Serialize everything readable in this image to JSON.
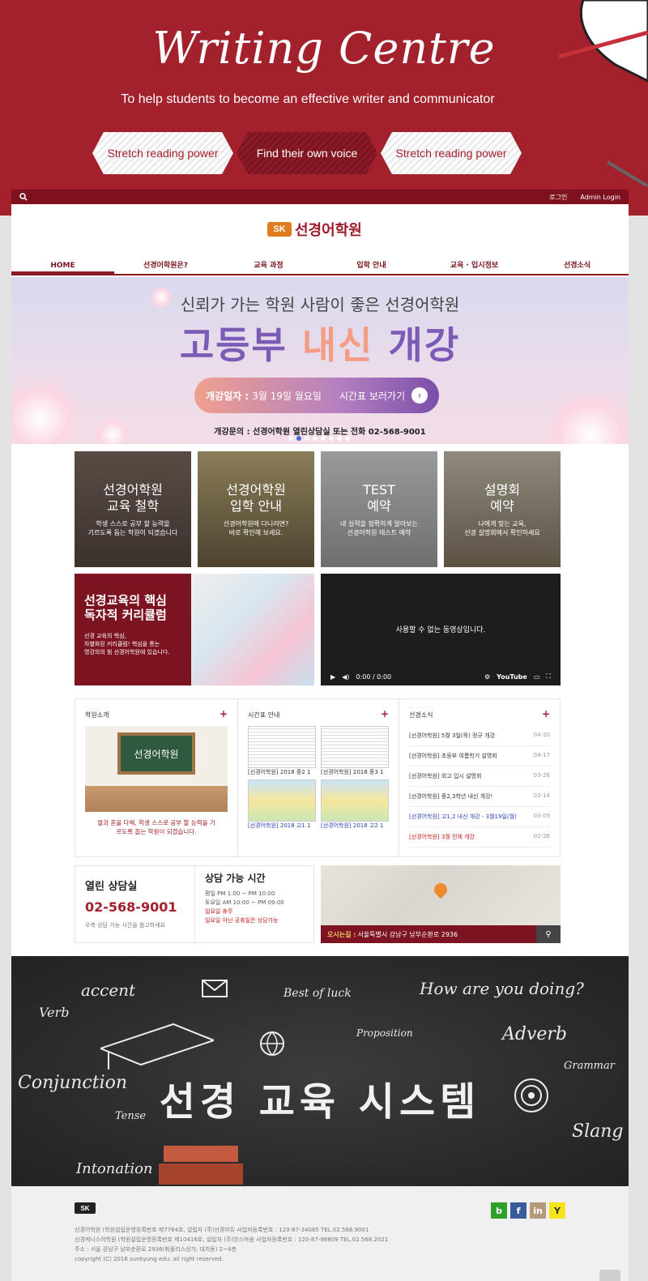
{
  "hero": {
    "title": "Writing Centre",
    "tagline": "To help students to become an effective writer and communicator",
    "pills": [
      "Stretch reading power",
      "Find their own voice",
      "Stretch reading power"
    ]
  },
  "topbar": {
    "search_icon": "search-icon",
    "login": "로그인",
    "admin": "Admin Login"
  },
  "logo": {
    "mark": "SK",
    "name": "선경어학원"
  },
  "nav": [
    "HOME",
    "선경어학원은?",
    "교육 과정",
    "입학 안내",
    "교육 · 입시정보",
    "선경소식"
  ],
  "banner": {
    "subtitle": "신뢰가 가는 학원 사람이 좋은 선경어학원",
    "title_a": "고등부 ",
    "title_b": "내신",
    "title_c": " 개강",
    "cta_label": "개강일자 :",
    "cta_date": "3월 19일 월요일",
    "cta_link": "시간표 보러가기",
    "info": "개강문의 : 선경어학원 열린상담실 또는 전화 02-568-9001"
  },
  "tiles": [
    {
      "title1": "선경어학원",
      "title2": "교육 철학",
      "sub1": "학생 스스로 공부 할 능력을",
      "sub2": "기르도록 돕는 학원이 되겠습니다"
    },
    {
      "title1": "선경어학원",
      "title2": "입학 안내",
      "sub1": "선경어학원에 다니려면?",
      "sub2": "바로 확인해 보세요."
    },
    {
      "title1": "TEST",
      "title2": "예약",
      "sub1": "내 실력을 정확하게 알아보는",
      "sub2": "선경어학원 테스트 예약"
    },
    {
      "title1": "설명회",
      "title2": "예약",
      "sub1": "나에게 맞는 교육,",
      "sub2": "선경 설명회에서 확인하세요"
    }
  ],
  "feature": {
    "title1": "선경교육의 핵심",
    "title2": "독자적 커리큘럼",
    "sub1": "선경 교육의 핵심,",
    "sub2": "차별화된 커리큘럼! 핵심을 통는",
    "sub3": "명강의의 힘 선경어학원에 있습니다."
  },
  "video": {
    "message": "사용할 수 없는 동영상입니다.",
    "time": "0:00 / 0:00",
    "brand": "YouTube"
  },
  "about": {
    "heading": "학원소개",
    "board_text": "선경어학원",
    "caption1": "열과 혼을 다해, 학생 스스로 공부 할 능력을 기",
    "caption2": "르도록 돕는 학원이 되겠습니다."
  },
  "timetable": {
    "heading": "시간표 안내",
    "items": [
      {
        "label": "[선경어학원] 2018 중2 1"
      },
      {
        "label": "[선경어학원] 2018 중3 1"
      },
      {
        "label": "[선경어학원] 2018 고1 1"
      },
      {
        "label": "[선경어학원] 2018 고2 1"
      }
    ]
  },
  "news": {
    "heading": "선경소식",
    "items": [
      {
        "text": "[선경어학원] 5월 3일(목) 정규 개강",
        "date": "04-20"
      },
      {
        "text": "[선경어학원] 초등부 여름학기 설명회",
        "date": "04-17"
      },
      {
        "text": "[선경어학원] 외고 입시 설명회",
        "date": "03-26"
      },
      {
        "text": "[선경어학원] 중2,3학년 내신 개강!",
        "date": "03-14"
      },
      {
        "text": "[선경어학원] 고1,2 내신 개강 - 3월19일(월)",
        "date": "03-09"
      },
      {
        "text": "[선경어학원] 3월 전체 개강",
        "date": "02-26"
      }
    ]
  },
  "contact": {
    "heading": "열린 상담실",
    "phone": "02-568-9001",
    "note": "우측 상담 가능 시간을 참고하세요",
    "hours_heading": "상담 가능 시간",
    "weekday": "평일 PM 1:00 ~ PM 10:00",
    "saturday": "토요일 AM 10:00 ~ PM 09:00",
    "sunday": "일요일 휴무",
    "holiday": "일요일 아닌 공휴일은 상담가능"
  },
  "map": {
    "addr_label": "오시는길 :",
    "addr": "서울특별시 강남구 남부순환로 2936",
    "pin_icon": "location-pin-icon"
  },
  "chalkboard": {
    "words": [
      "accent",
      "Verb",
      "Best of luck",
      "How are you doing?",
      "Proposition",
      "Adverb",
      "Grammar",
      "Conjunction",
      "Tense",
      "Slang",
      "Intonation"
    ],
    "title": "선경 교육 시스템"
  },
  "footer": {
    "logo": "SK",
    "line1": "선경어학원 (학원설립운영등록번호 제7764호, 설립자 (주)선경어듀   사업자등록번호 : 120-87-34085 TEL.02.568.9001",
    "line2": "선경케니스어학원 (학원설립운영등록번호 제10416호, 설립자 (주)앙스마음   사업자등록번호 : 120-87-98809 TEL.02.568.2021",
    "line3": "주소 : 서울 강남구 남부순환로 2936(휘플리스상가, 대치동) 2~4층",
    "line4": "copyright (C) 2016 sunkyung edu. all right reserved.",
    "social": [
      {
        "icon": "blog-icon",
        "glyph": "b",
        "color": "#2fa12a"
      },
      {
        "icon": "facebook-icon",
        "glyph": "f",
        "color": "#3a5b9b"
      },
      {
        "icon": "linkedin-icon",
        "glyph": "in",
        "color": "#b49a7a"
      },
      {
        "icon": "yellow-id-icon",
        "glyph": "Y",
        "color": "#f6e51b"
      }
    ]
  }
}
